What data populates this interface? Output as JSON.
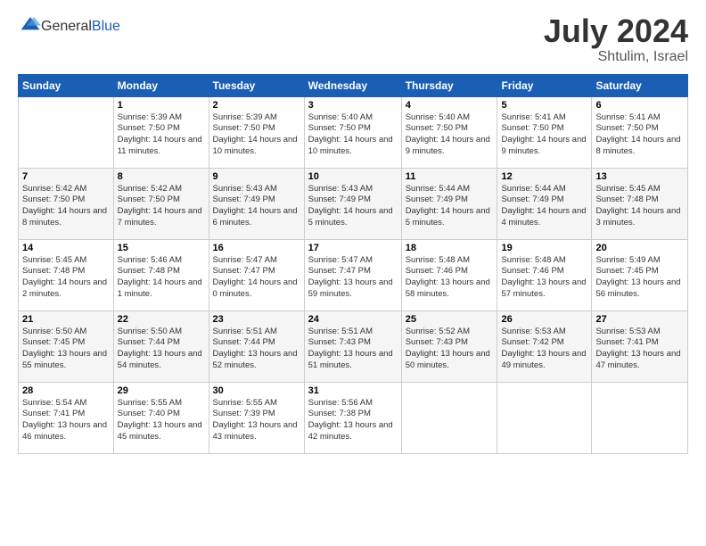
{
  "logo": {
    "general": "General",
    "blue": "Blue"
  },
  "title": {
    "month_year": "July 2024",
    "location": "Shtulim, Israel"
  },
  "days_of_week": [
    "Sunday",
    "Monday",
    "Tuesday",
    "Wednesday",
    "Thursday",
    "Friday",
    "Saturday"
  ],
  "weeks": [
    [
      {
        "day": "",
        "sunrise": "",
        "sunset": "",
        "daylight": ""
      },
      {
        "day": "1",
        "sunrise": "Sunrise: 5:39 AM",
        "sunset": "Sunset: 7:50 PM",
        "daylight": "Daylight: 14 hours and 11 minutes."
      },
      {
        "day": "2",
        "sunrise": "Sunrise: 5:39 AM",
        "sunset": "Sunset: 7:50 PM",
        "daylight": "Daylight: 14 hours and 10 minutes."
      },
      {
        "day": "3",
        "sunrise": "Sunrise: 5:40 AM",
        "sunset": "Sunset: 7:50 PM",
        "daylight": "Daylight: 14 hours and 10 minutes."
      },
      {
        "day": "4",
        "sunrise": "Sunrise: 5:40 AM",
        "sunset": "Sunset: 7:50 PM",
        "daylight": "Daylight: 14 hours and 9 minutes."
      },
      {
        "day": "5",
        "sunrise": "Sunrise: 5:41 AM",
        "sunset": "Sunset: 7:50 PM",
        "daylight": "Daylight: 14 hours and 9 minutes."
      },
      {
        "day": "6",
        "sunrise": "Sunrise: 5:41 AM",
        "sunset": "Sunset: 7:50 PM",
        "daylight": "Daylight: 14 hours and 8 minutes."
      }
    ],
    [
      {
        "day": "7",
        "sunrise": "Sunrise: 5:42 AM",
        "sunset": "Sunset: 7:50 PM",
        "daylight": "Daylight: 14 hours and 8 minutes."
      },
      {
        "day": "8",
        "sunrise": "Sunrise: 5:42 AM",
        "sunset": "Sunset: 7:50 PM",
        "daylight": "Daylight: 14 hours and 7 minutes."
      },
      {
        "day": "9",
        "sunrise": "Sunrise: 5:43 AM",
        "sunset": "Sunset: 7:49 PM",
        "daylight": "Daylight: 14 hours and 6 minutes."
      },
      {
        "day": "10",
        "sunrise": "Sunrise: 5:43 AM",
        "sunset": "Sunset: 7:49 PM",
        "daylight": "Daylight: 14 hours and 5 minutes."
      },
      {
        "day": "11",
        "sunrise": "Sunrise: 5:44 AM",
        "sunset": "Sunset: 7:49 PM",
        "daylight": "Daylight: 14 hours and 5 minutes."
      },
      {
        "day": "12",
        "sunrise": "Sunrise: 5:44 AM",
        "sunset": "Sunset: 7:49 PM",
        "daylight": "Daylight: 14 hours and 4 minutes."
      },
      {
        "day": "13",
        "sunrise": "Sunrise: 5:45 AM",
        "sunset": "Sunset: 7:48 PM",
        "daylight": "Daylight: 14 hours and 3 minutes."
      }
    ],
    [
      {
        "day": "14",
        "sunrise": "Sunrise: 5:45 AM",
        "sunset": "Sunset: 7:48 PM",
        "daylight": "Daylight: 14 hours and 2 minutes."
      },
      {
        "day": "15",
        "sunrise": "Sunrise: 5:46 AM",
        "sunset": "Sunset: 7:48 PM",
        "daylight": "Daylight: 14 hours and 1 minute."
      },
      {
        "day": "16",
        "sunrise": "Sunrise: 5:47 AM",
        "sunset": "Sunset: 7:47 PM",
        "daylight": "Daylight: 14 hours and 0 minutes."
      },
      {
        "day": "17",
        "sunrise": "Sunrise: 5:47 AM",
        "sunset": "Sunset: 7:47 PM",
        "daylight": "Daylight: 13 hours and 59 minutes."
      },
      {
        "day": "18",
        "sunrise": "Sunrise: 5:48 AM",
        "sunset": "Sunset: 7:46 PM",
        "daylight": "Daylight: 13 hours and 58 minutes."
      },
      {
        "day": "19",
        "sunrise": "Sunrise: 5:48 AM",
        "sunset": "Sunset: 7:46 PM",
        "daylight": "Daylight: 13 hours and 57 minutes."
      },
      {
        "day": "20",
        "sunrise": "Sunrise: 5:49 AM",
        "sunset": "Sunset: 7:45 PM",
        "daylight": "Daylight: 13 hours and 56 minutes."
      }
    ],
    [
      {
        "day": "21",
        "sunrise": "Sunrise: 5:50 AM",
        "sunset": "Sunset: 7:45 PM",
        "daylight": "Daylight: 13 hours and 55 minutes."
      },
      {
        "day": "22",
        "sunrise": "Sunrise: 5:50 AM",
        "sunset": "Sunset: 7:44 PM",
        "daylight": "Daylight: 13 hours and 54 minutes."
      },
      {
        "day": "23",
        "sunrise": "Sunrise: 5:51 AM",
        "sunset": "Sunset: 7:44 PM",
        "daylight": "Daylight: 13 hours and 52 minutes."
      },
      {
        "day": "24",
        "sunrise": "Sunrise: 5:51 AM",
        "sunset": "Sunset: 7:43 PM",
        "daylight": "Daylight: 13 hours and 51 minutes."
      },
      {
        "day": "25",
        "sunrise": "Sunrise: 5:52 AM",
        "sunset": "Sunset: 7:43 PM",
        "daylight": "Daylight: 13 hours and 50 minutes."
      },
      {
        "day": "26",
        "sunrise": "Sunrise: 5:53 AM",
        "sunset": "Sunset: 7:42 PM",
        "daylight": "Daylight: 13 hours and 49 minutes."
      },
      {
        "day": "27",
        "sunrise": "Sunrise: 5:53 AM",
        "sunset": "Sunset: 7:41 PM",
        "daylight": "Daylight: 13 hours and 47 minutes."
      }
    ],
    [
      {
        "day": "28",
        "sunrise": "Sunrise: 5:54 AM",
        "sunset": "Sunset: 7:41 PM",
        "daylight": "Daylight: 13 hours and 46 minutes."
      },
      {
        "day": "29",
        "sunrise": "Sunrise: 5:55 AM",
        "sunset": "Sunset: 7:40 PM",
        "daylight": "Daylight: 13 hours and 45 minutes."
      },
      {
        "day": "30",
        "sunrise": "Sunrise: 5:55 AM",
        "sunset": "Sunset: 7:39 PM",
        "daylight": "Daylight: 13 hours and 43 minutes."
      },
      {
        "day": "31",
        "sunrise": "Sunrise: 5:56 AM",
        "sunset": "Sunset: 7:38 PM",
        "daylight": "Daylight: 13 hours and 42 minutes."
      },
      {
        "day": "",
        "sunrise": "",
        "sunset": "",
        "daylight": ""
      },
      {
        "day": "",
        "sunrise": "",
        "sunset": "",
        "daylight": ""
      },
      {
        "day": "",
        "sunrise": "",
        "sunset": "",
        "daylight": ""
      }
    ]
  ]
}
